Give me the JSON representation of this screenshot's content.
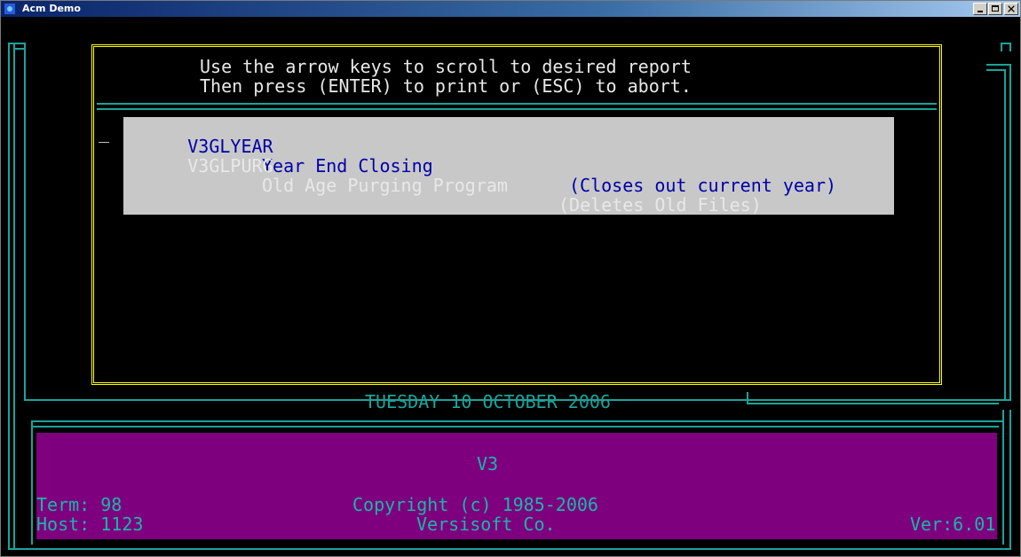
{
  "window": {
    "title": "Acm Demo"
  },
  "header": {
    "line1": "Use the arrow keys to scroll to desired report",
    "line2": "Then press (ENTER) to print or (ESC) to abort."
  },
  "reports": [
    {
      "code": "V3GLYEAR",
      "name": "Year End Closing",
      "desc": "(Closes out current year)",
      "selected": true
    },
    {
      "code": "V3GLPURG",
      "name": "Old Age Purging Program",
      "desc": "(Deletes Old Files)",
      "selected": false
    }
  ],
  "date": "TUESDAY 10 OCTOBER 2006",
  "footer": {
    "product": "V3",
    "term": "Term: 98",
    "host": "Host: 1123",
    "copyright": "Copyright (c) 1985-2006",
    "company": "Versisoft Co.",
    "version": "Ver:6.01"
  },
  "colors": {
    "border": "#ffff00",
    "lines": "#1aa39a",
    "footer_bg": "#7f007f",
    "highlight_bg": "#c8c8c8",
    "highlight_fg": "#0000a8"
  }
}
